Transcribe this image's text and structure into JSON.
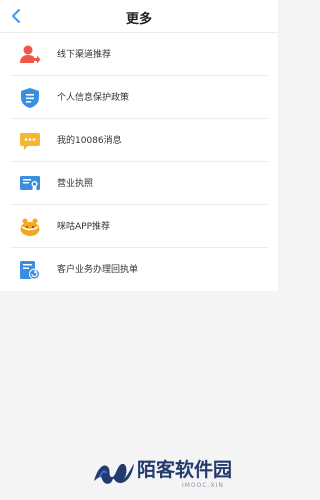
{
  "header": {
    "title": "更多",
    "back_icon": "back-chevron-icon"
  },
  "menu": {
    "items": [
      {
        "label": "线下渠道推荐",
        "icon": "person-share-icon",
        "color": "#f2564a"
      },
      {
        "label": "个人信息保护政策",
        "icon": "shield-doc-icon",
        "color": "#3b8de0"
      },
      {
        "label": "我的10086消息",
        "icon": "chat-bubble-icon",
        "color": "#f5b731"
      },
      {
        "label": "营业执照",
        "icon": "certificate-icon",
        "color": "#3b8de0"
      },
      {
        "label": "咪咕APP推荐",
        "icon": "migu-bird-icon",
        "color": "#f5a623"
      },
      {
        "label": "客户业务办理回执单",
        "icon": "receipt-refresh-icon",
        "color": "#3b8de0"
      }
    ]
  },
  "watermark": {
    "title": "陌客软件园",
    "subtitle": "IMOOC.XIN",
    "color": "#223a6e"
  }
}
